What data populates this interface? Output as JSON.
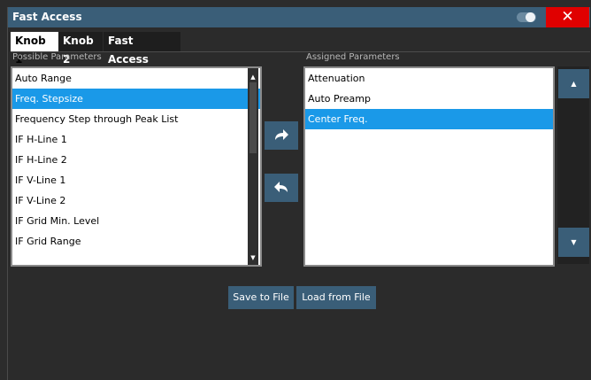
{
  "dialog": {
    "title": "Fast Access",
    "close_glyph": "✕"
  },
  "tabs": [
    {
      "label": "Knob 1"
    },
    {
      "label": "Knob 2"
    },
    {
      "label": "Fast Access"
    }
  ],
  "possible": {
    "label": "Possible Parameters",
    "items": [
      "Auto Range",
      "Freq. Stepsize",
      "Frequency Step through Peak List",
      "IF  H-Line 1",
      "IF  H-Line 2",
      "IF  V-Line 1",
      "IF  V-Line 2",
      "IF Grid Min. Level",
      "IF Grid Range"
    ],
    "selected_index": 1
  },
  "assigned": {
    "label": "Assigned Parameters",
    "items": [
      "Attenuation",
      "Auto Preamp",
      "Center Freq."
    ],
    "selected_index": 2
  },
  "icons": {
    "add": "add-arrow-icon",
    "remove": "remove-arrow-icon",
    "up": "up-triangle-icon",
    "down": "down-triangle-icon"
  },
  "actions": {
    "save_label": "Save to File",
    "load_label": "Load from File"
  },
  "colors": {
    "title_bar": "#3a5e78",
    "selection": "#1a99e8",
    "close": "#e00000"
  }
}
